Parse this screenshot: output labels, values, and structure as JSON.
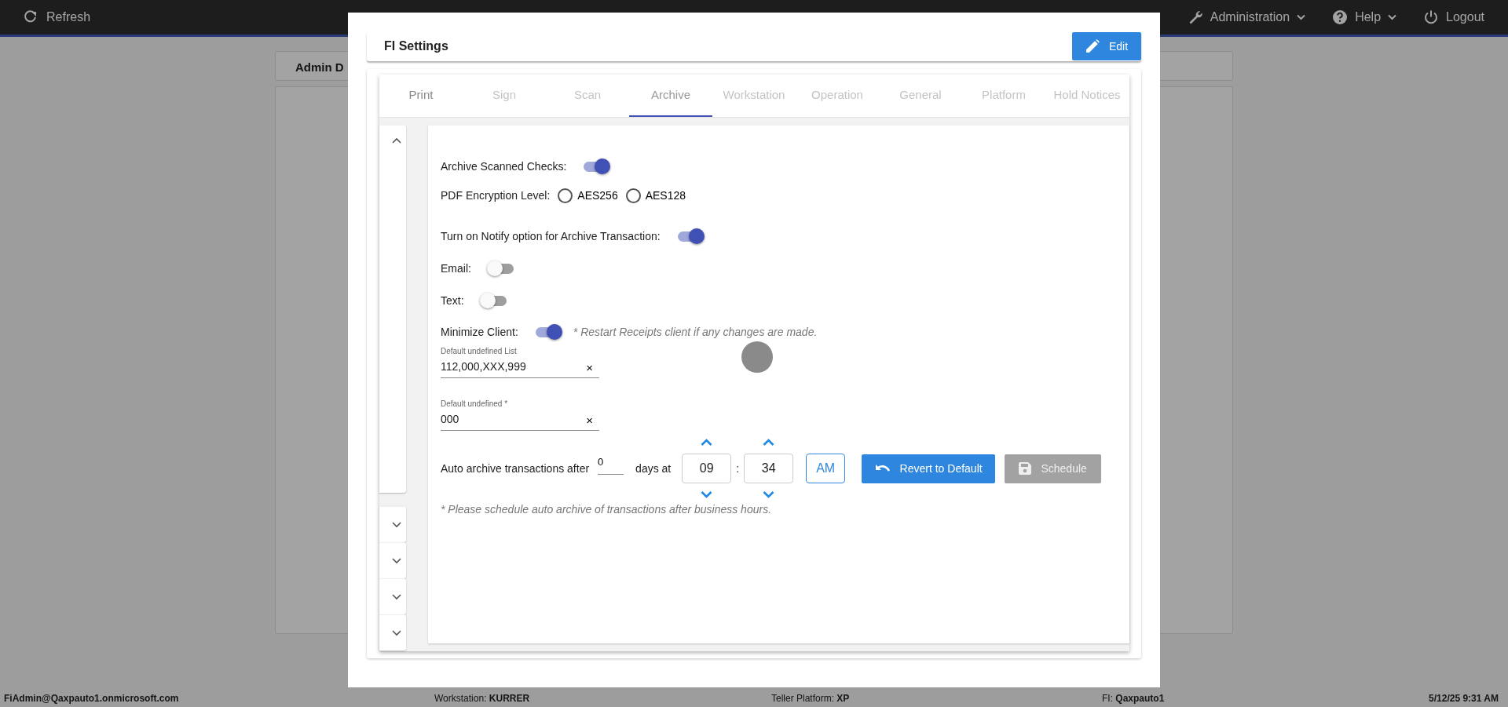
{
  "top_bar": {
    "items": [
      {
        "label": "Refresh",
        "kind": "action"
      },
      {
        "label": "Administration",
        "kind": "menu"
      },
      {
        "label": "Help",
        "kind": "menu"
      },
      {
        "label": "Logout",
        "kind": "action"
      }
    ]
  },
  "background_page": {
    "panel_title": "Admin D"
  },
  "dialog": {
    "title": "FI Settings",
    "edit_button": "Edit",
    "tabs": [
      {
        "label": "Print",
        "selected": false,
        "disabled": false
      },
      {
        "label": "Sign",
        "selected": false,
        "disabled": true
      },
      {
        "label": "Scan",
        "selected": false,
        "disabled": true
      },
      {
        "label": "Archive",
        "selected": true,
        "disabled": false
      },
      {
        "label": "Workstation",
        "selected": false,
        "disabled": true
      },
      {
        "label": "Operation",
        "selected": false,
        "disabled": true
      },
      {
        "label": "General",
        "selected": false,
        "disabled": true
      },
      {
        "label": "Platform",
        "selected": false,
        "disabled": true
      },
      {
        "label": "Hold Notices",
        "selected": false,
        "disabled": true
      }
    ],
    "accordion": [
      {
        "expanded": true
      },
      {
        "expanded": false
      },
      {
        "expanded": false
      },
      {
        "expanded": false
      },
      {
        "expanded": false
      }
    ],
    "settings": [
      {
        "kind": "toggle",
        "label": "Archive Scanned Checks:",
        "on": true
      },
      {
        "kind": "radio",
        "label": "PDF Encryption Level:",
        "options": [
          {
            "label": "AES256",
            "selected": false
          },
          {
            "label": "AES128",
            "selected": false
          }
        ]
      },
      {
        "kind": "toggle",
        "label": "Turn on Notify option for Archive Transaction:",
        "on": true
      },
      {
        "kind": "toggle",
        "label": "Email:",
        "on": false
      },
      {
        "kind": "toggle",
        "label": "Text:",
        "on": false
      },
      {
        "kind": "toggle",
        "label": "Minimize Client:",
        "on": true,
        "note": "* Restart Receipts client if any changes are made."
      }
    ],
    "fields": [
      {
        "label": "Default undefined List",
        "value": "112,000,XXX,999",
        "clear": "×"
      },
      {
        "label": "Default undefined *",
        "value": "000",
        "clear": "×"
      }
    ],
    "schedule": {
      "label": "Auto archive transactions after",
      "days": "0",
      "days_label": "days at",
      "hour": "09",
      "separator": ":",
      "minute": "34",
      "ampm": "AM",
      "revert_button": "Revert to Default",
      "schedule_button": "Schedule",
      "schedule_disabled": true,
      "note": "* Please schedule auto archive of transactions after business hours."
    }
  },
  "status_bar": [
    {
      "text": "FiAdmin@Qaxpauto1.onmicrosoft.com",
      "kind": "user"
    },
    {
      "text": "Workstation: **KURRER**",
      "kind": "info"
    },
    {
      "text": "Teller Platform: **XP**",
      "kind": "info"
    },
    {
      "text": "FI: **Qaxpauto1**",
      "kind": "info"
    },
    {
      "text": "5/12/25 9:31 AM",
      "kind": "time"
    }
  ]
}
